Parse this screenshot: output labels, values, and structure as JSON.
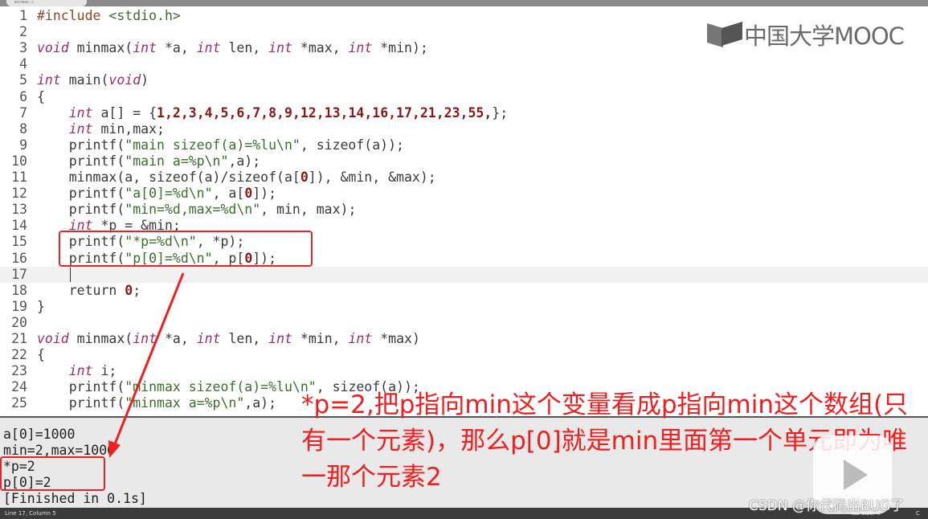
{
  "tab": {
    "title": "minmax.c"
  },
  "code": [
    [
      [
        "p",
        "#include"
      ],
      [
        "t",
        " "
      ],
      [
        "s",
        "<stdio.h>"
      ]
    ],
    [],
    [
      [
        "k",
        "void"
      ],
      [
        "t",
        " minmax("
      ],
      [
        "k",
        "int"
      ],
      [
        "t",
        " *a, "
      ],
      [
        "k",
        "int"
      ],
      [
        "t",
        " len, "
      ],
      [
        "k",
        "int"
      ],
      [
        "t",
        " *max, "
      ],
      [
        "k",
        "int"
      ],
      [
        "t",
        " *min);"
      ]
    ],
    [],
    [
      [
        "k",
        "int"
      ],
      [
        "t",
        " main("
      ],
      [
        "k",
        "void"
      ],
      [
        "t",
        ")"
      ]
    ],
    [
      [
        "t",
        "{"
      ]
    ],
    [
      [
        "t",
        "    "
      ],
      [
        "k",
        "int"
      ],
      [
        "t",
        " a[] = {"
      ],
      [
        "n",
        "1,2,3,4,5,6,7,8,9,12,13,14,16,17,21,23,55,"
      ],
      [
        "t",
        "};"
      ]
    ],
    [
      [
        "t",
        "    "
      ],
      [
        "k",
        "int"
      ],
      [
        "t",
        " min,max;"
      ]
    ],
    [
      [
        "t",
        "    printf("
      ],
      [
        "s",
        "\"main sizeof(a)=%lu\\n\""
      ],
      [
        "t",
        ", sizeof(a));"
      ]
    ],
    [
      [
        "t",
        "    printf("
      ],
      [
        "s",
        "\"main a=%p\\n\""
      ],
      [
        "t",
        ",a);"
      ]
    ],
    [
      [
        "t",
        "    minmax(a, sizeof(a)/sizeof(a["
      ],
      [
        "n",
        "0"
      ],
      [
        "t",
        "]), &min, &max);"
      ]
    ],
    [
      [
        "t",
        "    printf("
      ],
      [
        "s",
        "\"a[0]=%d\\n\""
      ],
      [
        "t",
        ", a["
      ],
      [
        "n",
        "0"
      ],
      [
        "t",
        "]);"
      ]
    ],
    [
      [
        "t",
        "    printf("
      ],
      [
        "s",
        "\"min=%d,max=%d\\n\""
      ],
      [
        "t",
        ", min, max);"
      ]
    ],
    [
      [
        "t",
        "    "
      ],
      [
        "k",
        "int"
      ],
      [
        "t",
        " *p = &min;"
      ]
    ],
    [
      [
        "t",
        "    printf("
      ],
      [
        "s",
        "\"*p=%d\\n\""
      ],
      [
        "t",
        ", *p);"
      ]
    ],
    [
      [
        "t",
        "    printf("
      ],
      [
        "s",
        "\"p[0]=%d\\n\""
      ],
      [
        "t",
        ", p["
      ],
      [
        "n",
        "0"
      ],
      [
        "t",
        "]);"
      ]
    ],
    [],
    [
      [
        "t",
        "    return "
      ],
      [
        "n",
        "0"
      ],
      [
        "t",
        ";"
      ]
    ],
    [
      [
        "t",
        "}"
      ]
    ],
    [],
    [
      [
        "k",
        "void"
      ],
      [
        "t",
        " minmax("
      ],
      [
        "k",
        "int"
      ],
      [
        "t",
        " *a, "
      ],
      [
        "k",
        "int"
      ],
      [
        "t",
        " len, "
      ],
      [
        "k",
        "int"
      ],
      [
        "t",
        " *min, "
      ],
      [
        "k",
        "int"
      ],
      [
        "t",
        " *max)"
      ]
    ],
    [
      [
        "t",
        "{"
      ]
    ],
    [
      [
        "t",
        "    "
      ],
      [
        "k",
        "int"
      ],
      [
        "t",
        " i;"
      ]
    ],
    [
      [
        "t",
        "    printf("
      ],
      [
        "s",
        "\"minmax sizeof(a)=%lu\\n\""
      ],
      [
        "t",
        ", sizeof(a));"
      ]
    ],
    [
      [
        "t",
        "    printf("
      ],
      [
        "s",
        "\"minmax a=%p\\n\""
      ],
      [
        "t",
        ",a);"
      ]
    ]
  ],
  "current_line": 17,
  "output": [
    "a[0]=1000",
    "min=2,max=1000",
    "*p=2",
    "p[0]=2",
    "[Finished in 0.1s]"
  ],
  "status": {
    "position": "Line 17, Column 5",
    "tab_size": "Tab Size: 4",
    "syntax": "C"
  },
  "annotation": "*p=2,把p指向min这个变量看成p指向min这个数组(只有一个元素)，那么p[0]就是min里面第一个单元即为唯一那个元素2",
  "logo": {
    "text": "中国大学MOOC"
  },
  "watermark": "CSDN @你代码出BUG了",
  "colors": {
    "annotation": "#f01e1e",
    "keyword": "#9c2d6a",
    "number": "#8b1818",
    "string": "#3b6e2f"
  }
}
